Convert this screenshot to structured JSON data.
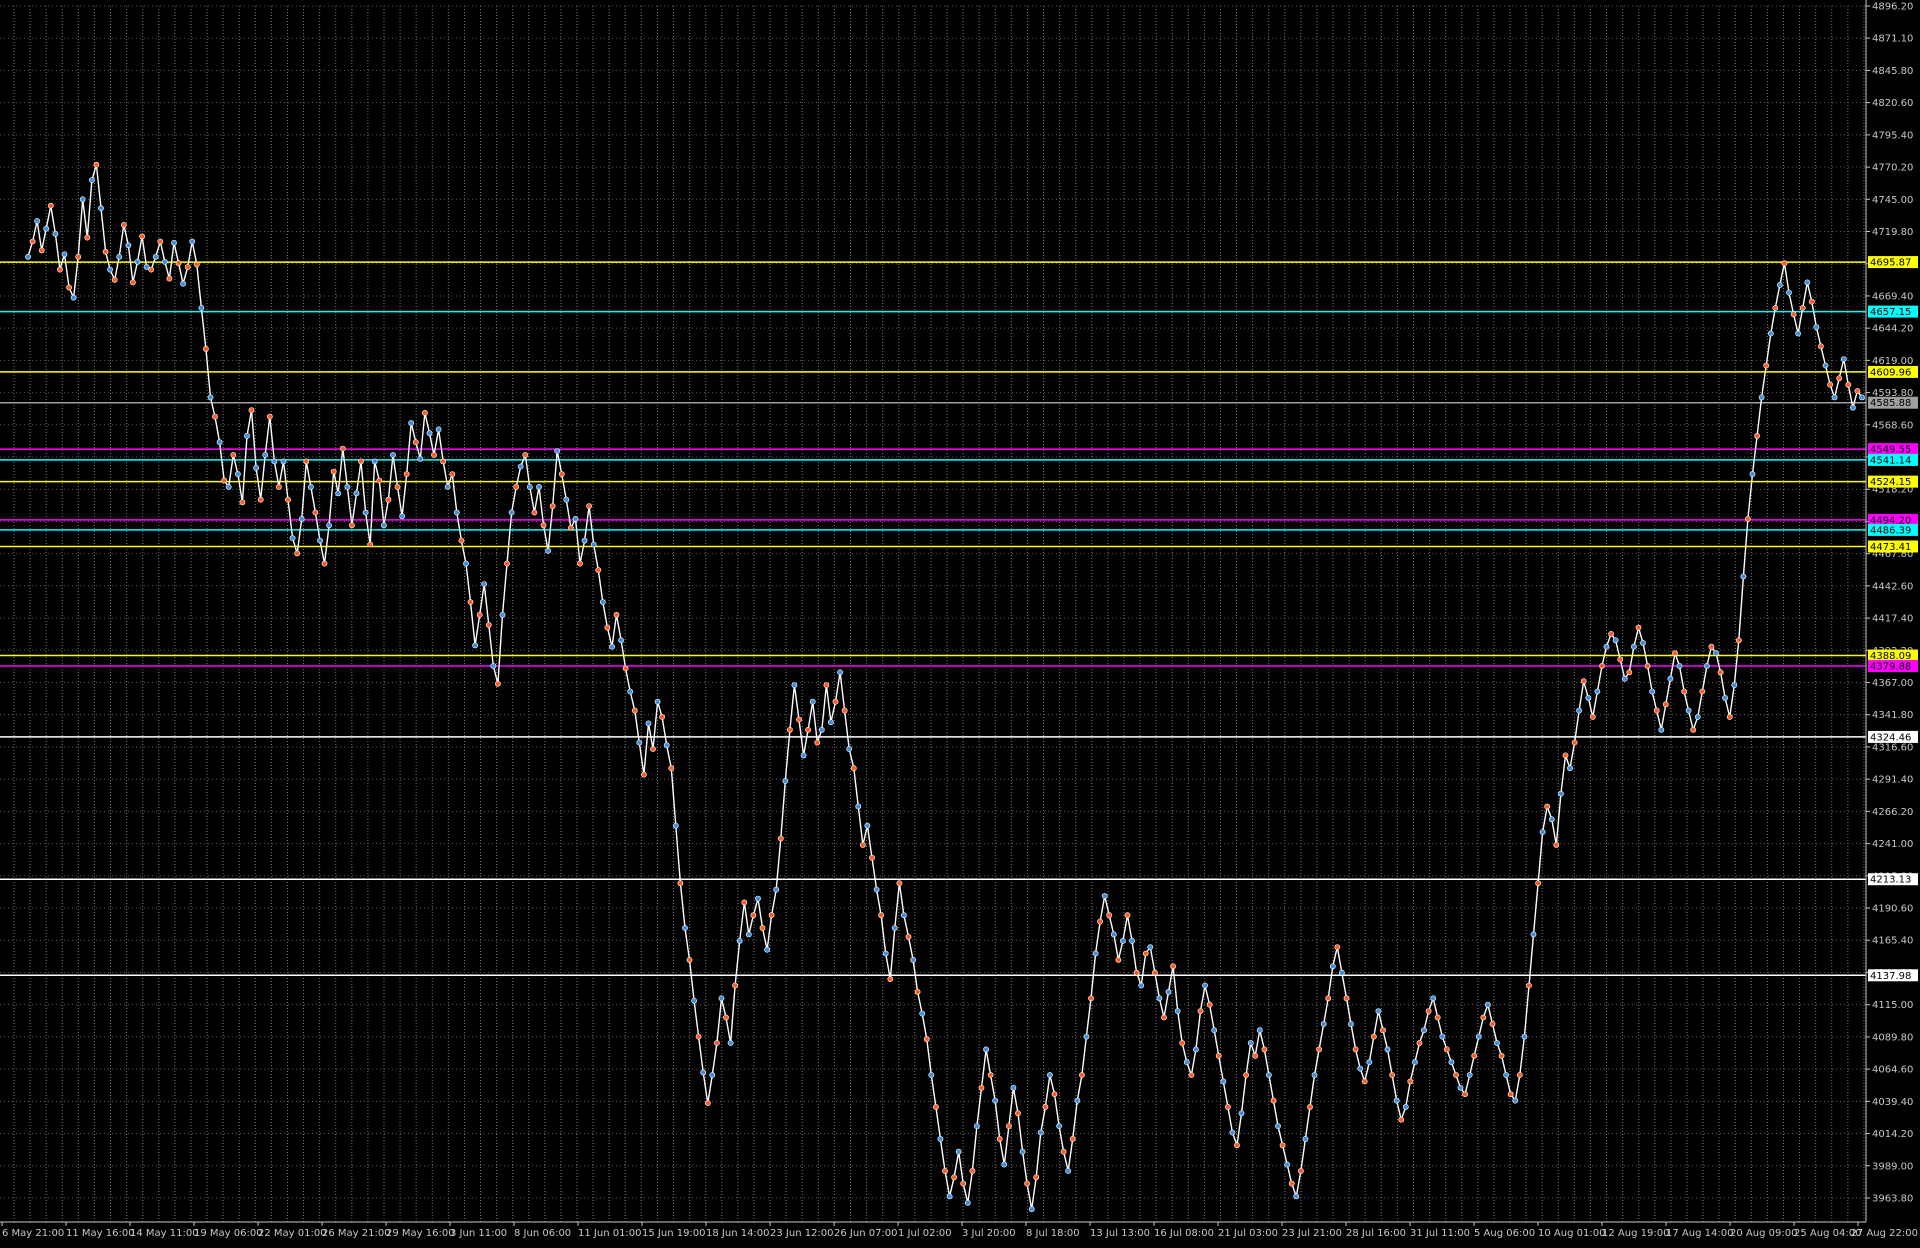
{
  "chart_data": {
    "type": "line",
    "title": "",
    "xlabel": "",
    "ylabel": "",
    "grid": true,
    "legend": "none",
    "ylim": [
      3945,
      4896.2
    ],
    "price_ticks": [
      "4896.20",
      "4871.10",
      "4845.80",
      "4820.60",
      "4795.40",
      "4770.20",
      "4745.00",
      "4719.80",
      "4694.60",
      "4669.40",
      "4644.20",
      "4619.00",
      "4593.80",
      "4568.60",
      "4543.40",
      "4518.20",
      "4493.00",
      "4467.80",
      "4442.60",
      "4417.40",
      "4392.20",
      "4367.00",
      "4341.80",
      "4316.60",
      "4291.40",
      "4266.20",
      "4241.00",
      "4215.80",
      "4190.60",
      "4165.40",
      "4140.20",
      "4115.00",
      "4089.80",
      "4064.60",
      "4039.40",
      "4014.20",
      "3989.00",
      "3963.80"
    ],
    "date_labels": [
      "6 May 21:00",
      "11 May 16:00",
      "14 May 11:00",
      "19 May 06:00",
      "22 May 01:00",
      "26 May 21:00",
      "29 May 16:00",
      "3 Jun 11:00",
      "8 Jun 06:00",
      "11 Jun 01:00",
      "15 Jun 19:00",
      "18 Jun 14:00",
      "23 Jun 12:00",
      "26 Jun 07:00",
      "1 Jul 02:00",
      "3 Jul 20:00",
      "8 Jul 18:00",
      "13 Jul 13:00",
      "16 Jul 08:00",
      "21 Jul 03:00",
      "23 Jul 21:00",
      "28 Jul 16:00",
      "31 Jul 11:00",
      "5 Aug 06:00",
      "10 Aug 01:00",
      "12 Aug 19:00",
      "17 Aug 14:00",
      "20 Aug 09:00",
      "25 Aug 04:00",
      "27 Aug 22:00"
    ],
    "price_levels": [
      {
        "value": 4695.87,
        "label": "4695.87",
        "color": "#ffff00"
      },
      {
        "value": 4657.15,
        "label": "4657.15",
        "color": "#00ffff"
      },
      {
        "value": 4609.96,
        "label": "4609.96",
        "color": "#ffff00"
      },
      {
        "value": 4585.88,
        "label": "4585.88",
        "color": "#a0a0a0"
      },
      {
        "value": 4549.55,
        "label": "4549.55",
        "color": "#ff00ff"
      },
      {
        "value": 4541.14,
        "label": "4541.14",
        "color": "#00ffff"
      },
      {
        "value": 4524.15,
        "label": "4524.15",
        "color": "#ffff00"
      },
      {
        "value": 4494.2,
        "label": "4494.20",
        "color": "#ff00ff"
      },
      {
        "value": 4486.39,
        "label": "4486.39",
        "color": "#00ffff"
      },
      {
        "value": 4473.41,
        "label": "4473.41",
        "color": "#ffff00"
      },
      {
        "value": 4388.09,
        "label": "4388.09",
        "color": "#ffff00"
      },
      {
        "value": 4379.88,
        "label": "4379.88",
        "color": "#ff00ff"
      },
      {
        "value": 4324.46,
        "label": "4324.46",
        "color": "#ffffff"
      },
      {
        "value": 4213.13,
        "label": "4213.13",
        "color": "#ffffff"
      },
      {
        "value": 4137.98,
        "label": "4137.98",
        "color": "#ffffff"
      }
    ],
    "series": [
      {
        "values": [
          4700,
          4712,
          4728,
          4705,
          4722,
          4740,
          4718,
          4690,
          4702,
          4676,
          4668,
          4700,
          4745,
          4715,
          4760,
          4772,
          4738,
          4704,
          4690,
          4682,
          4700,
          4725,
          4709,
          4680,
          4696,
          4716,
          4692,
          4690,
          4700,
          4712,
          4696,
          4683,
          4711,
          4695,
          4679,
          4692,
          4712,
          4694,
          4660,
          4628,
          4590,
          4575,
          4555,
          4525,
          4520,
          4545,
          4530,
          4508,
          4560,
          4580,
          4535,
          4510,
          4545,
          4575,
          4540,
          4520,
          4540,
          4510,
          4480,
          4468,
          4495,
          4540,
          4520,
          4500,
          4478,
          4460,
          4490,
          4532,
          4515,
          4550,
          4520,
          4490,
          4515,
          4540,
          4500,
          4475,
          4540,
          4525,
          4490,
          4510,
          4545,
          4520,
          4497,
          4530,
          4570,
          4555,
          4542,
          4578,
          4562,
          4545,
          4565,
          4540,
          4520,
          4530,
          4500,
          4478,
          4460,
          4430,
          4396,
          4420,
          4444,
          4412,
          4380,
          4366,
          4420,
          4460,
          4500,
          4520,
          4536,
          4545,
          4520,
          4500,
          4520,
          4490,
          4470,
          4505,
          4548,
          4530,
          4510,
          4488,
          4495,
          4460,
          4478,
          4505,
          4475,
          4455,
          4430,
          4410,
          4395,
          4420,
          4400,
          4378,
          4360,
          4345,
          4320,
          4295,
          4335,
          4315,
          4352,
          4340,
          4318,
          4300,
          4255,
          4210,
          4175,
          4150,
          4118,
          4090,
          4062,
          4038,
          4060,
          4085,
          4120,
          4105,
          4085,
          4130,
          4165,
          4195,
          4170,
          4185,
          4198,
          4175,
          4158,
          4185,
          4205,
          4245,
          4290,
          4330,
          4365,
          4338,
          4310,
          4330,
          4352,
          4320,
          4330,
          4365,
          4336,
          4352,
          4375,
          4345,
          4315,
          4300,
          4270,
          4240,
          4255,
          4230,
          4205,
          4185,
          4155,
          4135,
          4175,
          4210,
          4185,
          4168,
          4150,
          4125,
          4108,
          4088,
          4060,
          4035,
          4010,
          3985,
          3965,
          3980,
          4000,
          3975,
          3960,
          3985,
          4020,
          4050,
          4080,
          4060,
          4040,
          4010,
          3990,
          4020,
          4050,
          4030,
          4000,
          3975,
          3955,
          3980,
          4015,
          4035,
          4060,
          4045,
          4020,
          4000,
          3985,
          4010,
          4040,
          4060,
          4090,
          4120,
          4155,
          4180,
          4200,
          4185,
          4170,
          4150,
          4165,
          4185,
          4165,
          4140,
          4130,
          4155,
          4160,
          4140,
          4120,
          4105,
          4125,
          4145,
          4110,
          4085,
          4070,
          4060,
          4080,
          4110,
          4130,
          4115,
          4095,
          4075,
          4055,
          4035,
          4015,
          4005,
          4030,
          4060,
          4085,
          4075,
          4095,
          4080,
          4060,
          4040,
          4020,
          4005,
          3990,
          3975,
          3965,
          3985,
          4010,
          4035,
          4060,
          4080,
          4100,
          4120,
          4145,
          4160,
          4140,
          4120,
          4100,
          4080,
          4065,
          4055,
          4070,
          4090,
          4110,
          4095,
          4080,
          4060,
          4040,
          4025,
          4035,
          4055,
          4070,
          4085,
          4095,
          4110,
          4120,
          4105,
          4090,
          4080,
          4070,
          4060,
          4050,
          4045,
          4060,
          4075,
          4090,
          4105,
          4115,
          4100,
          4085,
          4075,
          4060,
          4045,
          4040,
          4060,
          4090,
          4130,
          4170,
          4210,
          4250,
          4270,
          4260,
          4240,
          4280,
          4310,
          4300,
          4320,
          4345,
          4368,
          4355,
          4340,
          4360,
          4380,
          4395,
          4405,
          4400,
          4385,
          4370,
          4375,
          4395,
          4410,
          4398,
          4380,
          4360,
          4345,
          4330,
          4350,
          4370,
          4390,
          4380,
          4360,
          4345,
          4330,
          4340,
          4360,
          4380,
          4395,
          4390,
          4375,
          4355,
          4340,
          4365,
          4400,
          4450,
          4495,
          4530,
          4560,
          4590,
          4615,
          4640,
          4660,
          4678,
          4695,
          4672,
          4655,
          4640,
          4660,
          4680,
          4665,
          4645,
          4630,
          4615,
          4600,
          4590,
          4605,
          4620,
          4600,
          4582,
          4595,
          4590
        ]
      }
    ]
  }
}
